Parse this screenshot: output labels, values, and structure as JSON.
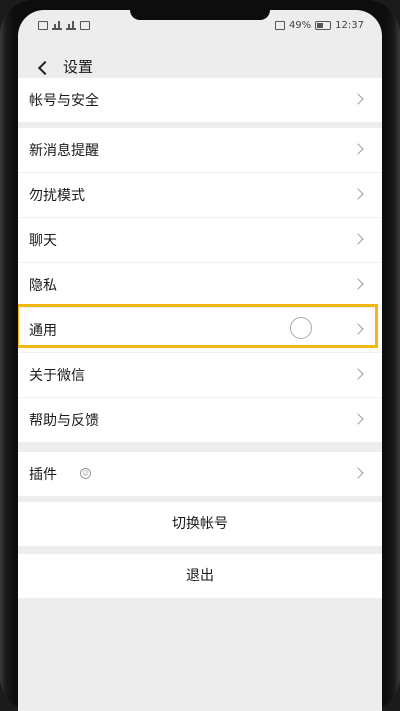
{
  "status_bar": {
    "battery_percent": "49%",
    "time": "12:37"
  },
  "nav": {
    "title": "设置"
  },
  "groups": {
    "account": [
      "帐号与安全"
    ],
    "main": [
      "新消息提醒",
      "勿扰模式",
      "聊天",
      "隐私",
      "通用",
      "关于微信",
      "帮助与反馈"
    ],
    "plugins": [
      "插件"
    ]
  },
  "buttons": {
    "switch_account": "切换帐号",
    "logout": "退出"
  },
  "colors": {
    "highlight": "#f2b712",
    "background": "#ededed"
  }
}
